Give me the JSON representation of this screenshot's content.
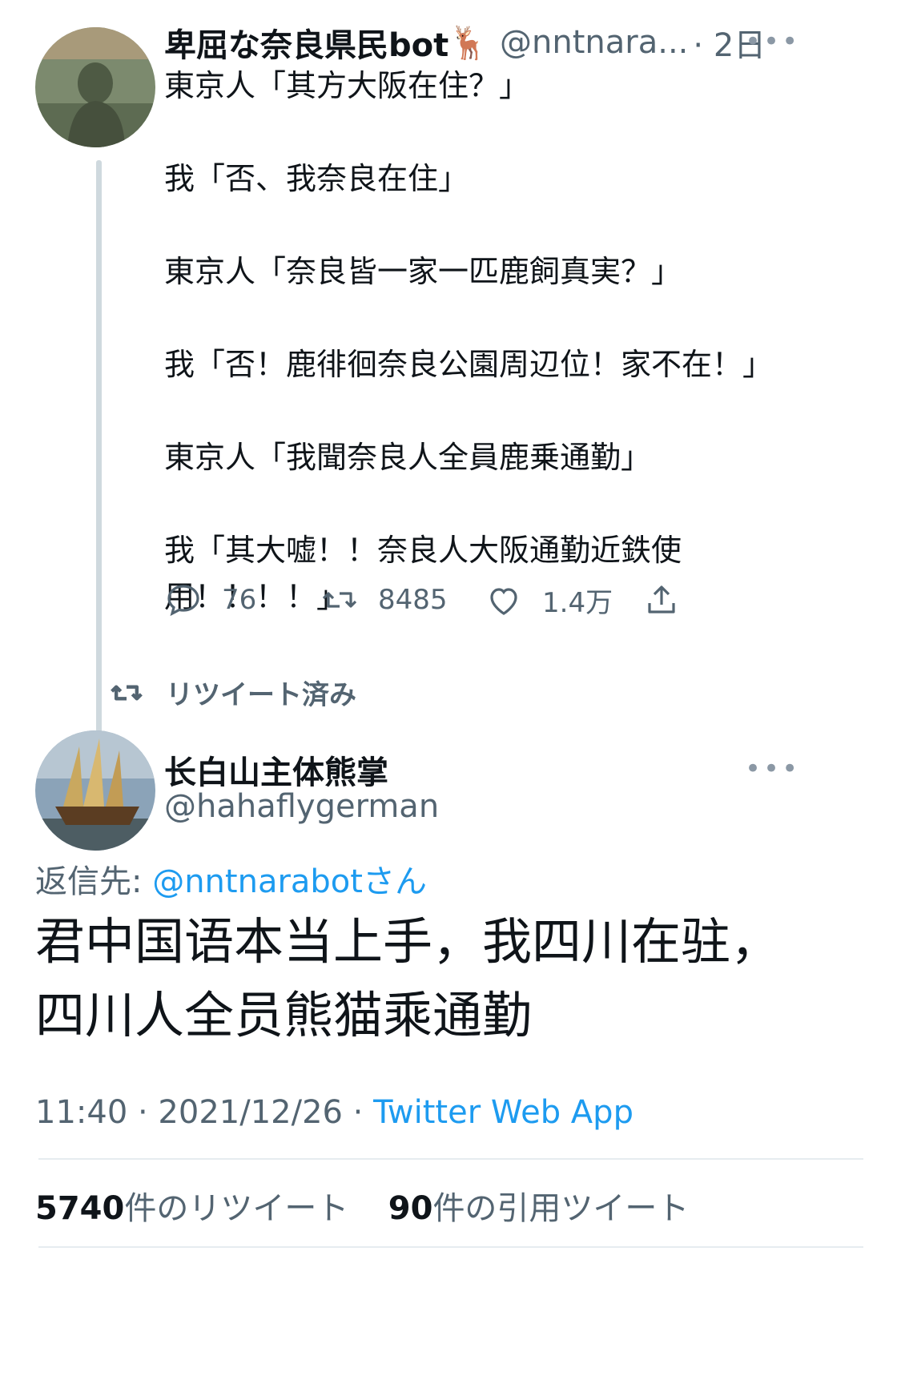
{
  "first_tweet": {
    "display_name": "卑屈な奈良県民bot",
    "name_emoji": "🦌",
    "handle": "@nntnara...",
    "time": "· 2日",
    "more": "•••",
    "text": "東京人「其方大阪在住？」\n\n我「否、我奈良在住」\n\n東京人「奈良皆一家一匹鹿飼真実？」\n\n我「否！鹿徘徊奈良公園周辺位！家不在！」\n\n東京人「我聞奈良人全員鹿乗通勤」\n\n我「其大嘘！！奈良人大阪通勤近鉄使\n用！！！！」",
    "actions": {
      "reply_count": "76",
      "retweet_count": "8485",
      "like_count": "1.4万"
    },
    "retweeted_label": "リツイート済み"
  },
  "main_tweet": {
    "display_name": "长白山主体熊掌",
    "handle": "@hahaflygerman",
    "more": "•••",
    "reply_to_prefix": "返信先: ",
    "reply_to_handle": "@nntnarabotさん",
    "text": "君中国语本当上手，我四川在驻，\n四川人全员熊猫乘通勤",
    "timestamp": "11:40 · 2021/12/26 · ",
    "source": "Twitter Web App",
    "stats": {
      "retweets_number": "5740",
      "retweets_label": "件のリツイート",
      "quotes_number": "90",
      "quotes_label": "件の引用ツイート"
    }
  },
  "colors": {
    "accent": "#1d9bf0",
    "secondary_text": "#536471",
    "divider": "#e6ecf0",
    "thread_line": "#cfd9de"
  }
}
